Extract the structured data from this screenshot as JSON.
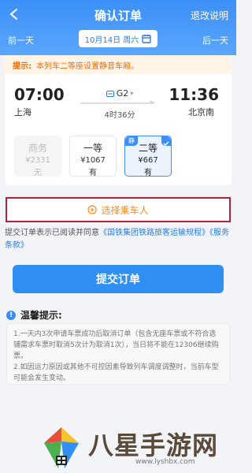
{
  "header": {
    "title": "确认订单",
    "refund_label": "退改说明",
    "prev_day": "前一天",
    "next_day": "后一天",
    "date": "10月14日 周六"
  },
  "trip": {
    "tip_prefix": "提示:",
    "tip_text": "本列车二等座设置静音车厢。",
    "dep_time": "07:00",
    "dep_station": "上海",
    "arr_time": "11:36",
    "arr_station": "北京南",
    "train_no": "G2",
    "duration": "4时36分"
  },
  "seats": [
    {
      "name": "商务",
      "price": "¥2331",
      "avail": "无",
      "state": "disabled"
    },
    {
      "name": "一等",
      "price": "¥1067",
      "avail": "有",
      "state": "normal"
    },
    {
      "name": "二等",
      "price": "¥667",
      "avail": "有",
      "state": "selected",
      "badge": "静"
    }
  ],
  "passenger": {
    "label": "选择乘车人"
  },
  "agreement": {
    "prefix": "提交订单表示已阅读并同意",
    "link1": "《国铁集团铁路旅客运输规程》",
    "link2": "《服务条款》"
  },
  "submit_label": "提交订单",
  "reminder": {
    "title": "温馨提示:",
    "line1": "1.一天内3次申请车票成功后取消订单（包含无座车票或不符合选铺需求车票时取消5次计为取消1次），当日将不能在12306继续购票。",
    "line2": "2.如因运力原因或其他不可控因素导致列车调度调整时，当前车型可能会发生变动。"
  },
  "watermark": {
    "text": "八星手游网",
    "url": "www.lyshbx.com"
  },
  "colors": {
    "primary": "#3b8ff7",
    "tip": "#ff6a00",
    "passenger": "#ff8a1e",
    "highlight_border": "#b3213a"
  }
}
